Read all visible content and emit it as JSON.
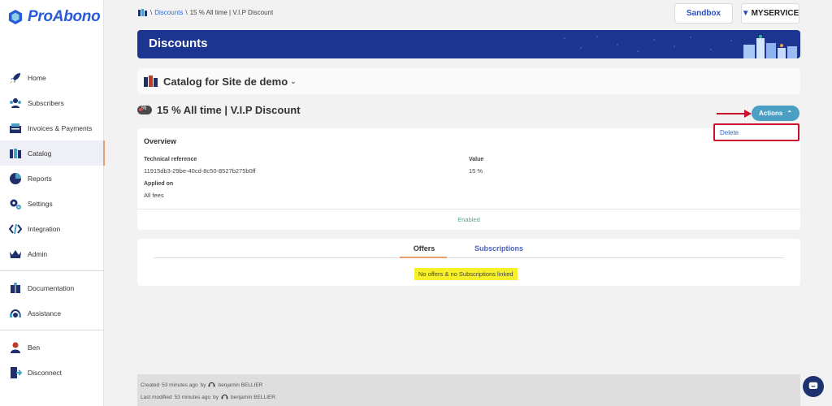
{
  "app": {
    "name": "ProAbono"
  },
  "sidebar": {
    "items": [
      {
        "label": "Home",
        "icon": "rocket-icon"
      },
      {
        "label": "Subscribers",
        "icon": "users-icon"
      },
      {
        "label": "Invoices & Payments",
        "icon": "invoices-icon"
      },
      {
        "label": "Catalog",
        "icon": "catalog-icon",
        "active": true
      },
      {
        "label": "Reports",
        "icon": "pie-chart-icon"
      },
      {
        "label": "Settings",
        "icon": "gear-icon"
      },
      {
        "label": "Integration",
        "icon": "code-icon"
      },
      {
        "label": "Admin",
        "icon": "crown-icon"
      }
    ],
    "help_items": [
      {
        "label": "Documentation",
        "icon": "book-icon"
      },
      {
        "label": "Assistance",
        "icon": "headset-icon"
      }
    ],
    "user_items": [
      {
        "label": "Ben",
        "icon": "user-icon"
      },
      {
        "label": "Disconnect",
        "icon": "logout-icon"
      }
    ]
  },
  "breadcrumb": {
    "root": "Discounts",
    "separator": "\\",
    "current": "15 % All time | V.I.P Discount"
  },
  "topbar": {
    "sandbox_label": "Sandbox",
    "brand_label": "MYSERVICE"
  },
  "banner": {
    "title": "Discounts"
  },
  "catalog": {
    "title": "Catalog for Site de demo"
  },
  "discount": {
    "title": "15 % All time | V.I.P Discount",
    "badge": "%",
    "actions_label": "Actions",
    "menu": [
      "Delete"
    ]
  },
  "overview": {
    "title": "Overview",
    "technical_reference_label": "Technical reference",
    "technical_reference": "11915db3-29be-40cd-8c50-8527b275b0ff",
    "value_label": "Value",
    "value": "15 %",
    "applied_on_label": "Applied on",
    "applied_on": "All fees",
    "status": "Enabled"
  },
  "tabs": {
    "items": [
      "Offers",
      "Subscriptions"
    ],
    "active": "Offers",
    "empty_message": "No offers & no Subscriptions linked"
  },
  "footer": {
    "created_label": "Created",
    "created_time": "53 minutes ago",
    "modified_label": "Last modified",
    "modified_time": "53 minutes ago",
    "by": "by",
    "author": "benjamin BELLIER"
  },
  "colors": {
    "brand_blue": "#2a5bd7",
    "banner": "#1c3590",
    "actions": "#4b9ec4",
    "highlight": "#c8102e",
    "status_enabled": "#3bb77e",
    "empty_highlight": "#f6f02a"
  }
}
